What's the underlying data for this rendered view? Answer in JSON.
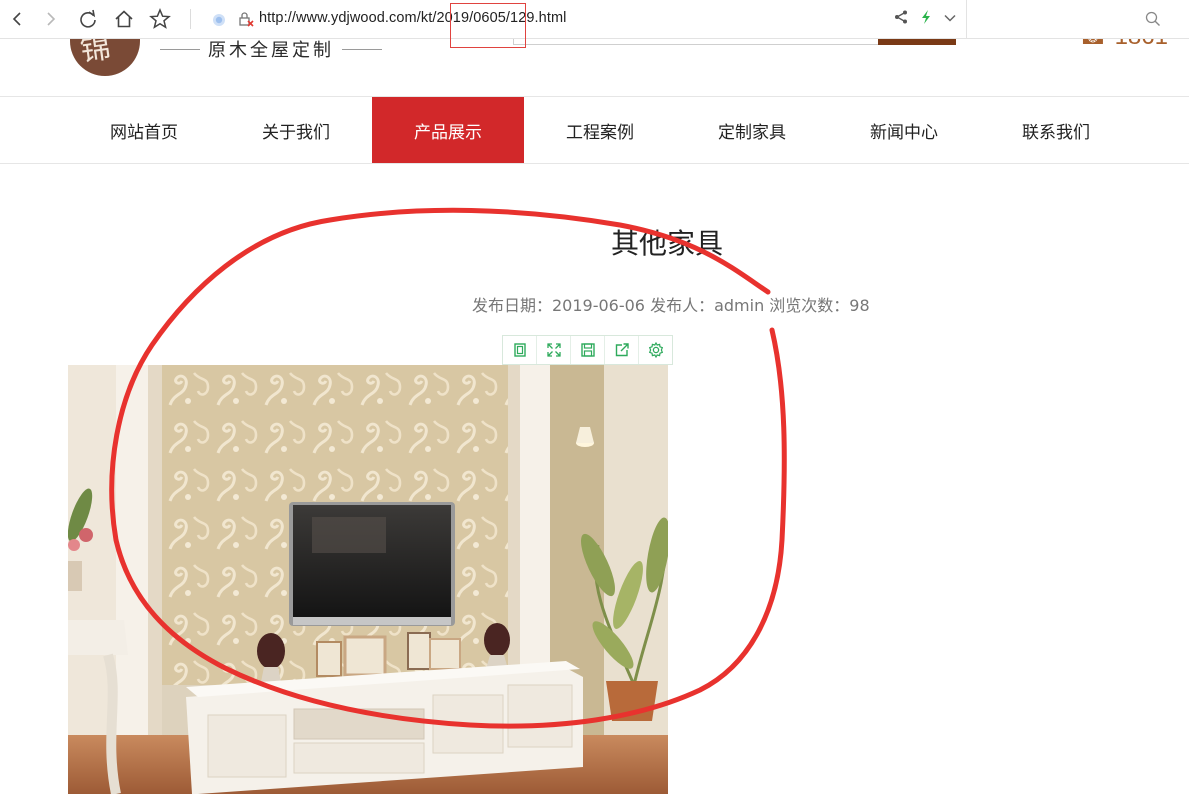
{
  "browser": {
    "url": "http://www.ydjwood.com/kt/2019/0605/129.html",
    "icons": [
      "back-icon",
      "forward-icon",
      "reload-icon",
      "home-icon",
      "star-icon",
      "site-info-icon",
      "security-warning-icon",
      "share-icon",
      "lightning-icon",
      "chevron-down-icon",
      "search-icon"
    ]
  },
  "header": {
    "logo_glyph": "锦",
    "tagline": "原木全屋定制",
    "phone_partial": "☎ 1861"
  },
  "nav": {
    "items": [
      {
        "label": "网站首页",
        "active": false
      },
      {
        "label": "关于我们",
        "active": false
      },
      {
        "label": "产品展示",
        "active": true
      },
      {
        "label": "工程案例",
        "active": false
      },
      {
        "label": "定制家具",
        "active": false
      },
      {
        "label": "新闻中心",
        "active": false
      },
      {
        "label": "联系我们",
        "active": false
      }
    ]
  },
  "article": {
    "title": "其他家具",
    "meta": "发布日期：2019-06-06 发布人：admin 浏览次数：98"
  },
  "image_toolbar": {
    "icons": [
      "copy-icon",
      "fullscreen-icon",
      "save-icon",
      "share-out-icon",
      "settings-icon"
    ],
    "color": "#2eaa5c"
  },
  "colors": {
    "nav_active": "#d2282a",
    "annotation": "#e8322e",
    "logo": "#7a4a36"
  }
}
